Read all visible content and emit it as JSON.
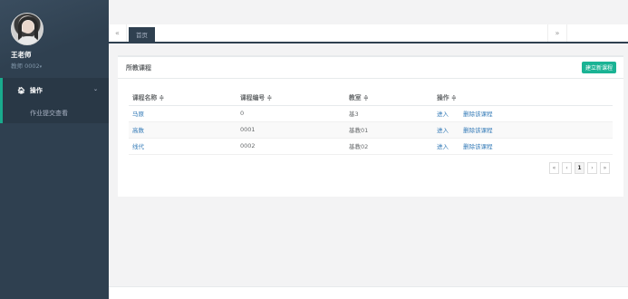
{
  "profile": {
    "name": "王老师",
    "role": "教师 0002",
    "role_caret": "▾"
  },
  "sidebar": {
    "section": {
      "label": "操作",
      "icon": "home-icon"
    },
    "items": [
      {
        "label": "作业提交查看"
      }
    ]
  },
  "tabs": {
    "prev": "«",
    "home": "首页",
    "next": "»"
  },
  "panel": {
    "title": "所教课程",
    "new_button": "建立新课程"
  },
  "table": {
    "columns": [
      "课程名称 ≑",
      "课程编号 ≑",
      "教室 ≑",
      "操作 ≑"
    ],
    "rows": [
      {
        "name": "马原",
        "code": "0",
        "room": "基3",
        "enter": "进入",
        "delete": "删除该课程"
      },
      {
        "name": "高数",
        "code": "0001",
        "room": "基教01",
        "enter": "进入",
        "delete": "删除该课程"
      },
      {
        "name": "线代",
        "code": "0002",
        "room": "基教02",
        "enter": "进入",
        "delete": "删除该课程"
      }
    ]
  },
  "pagination": {
    "first": "«",
    "prev": "‹",
    "current": "1",
    "next": "›",
    "last": "»"
  },
  "colors": {
    "sidebar": "#2f4050",
    "accent": "#1ab394",
    "link": "#337ab7"
  }
}
